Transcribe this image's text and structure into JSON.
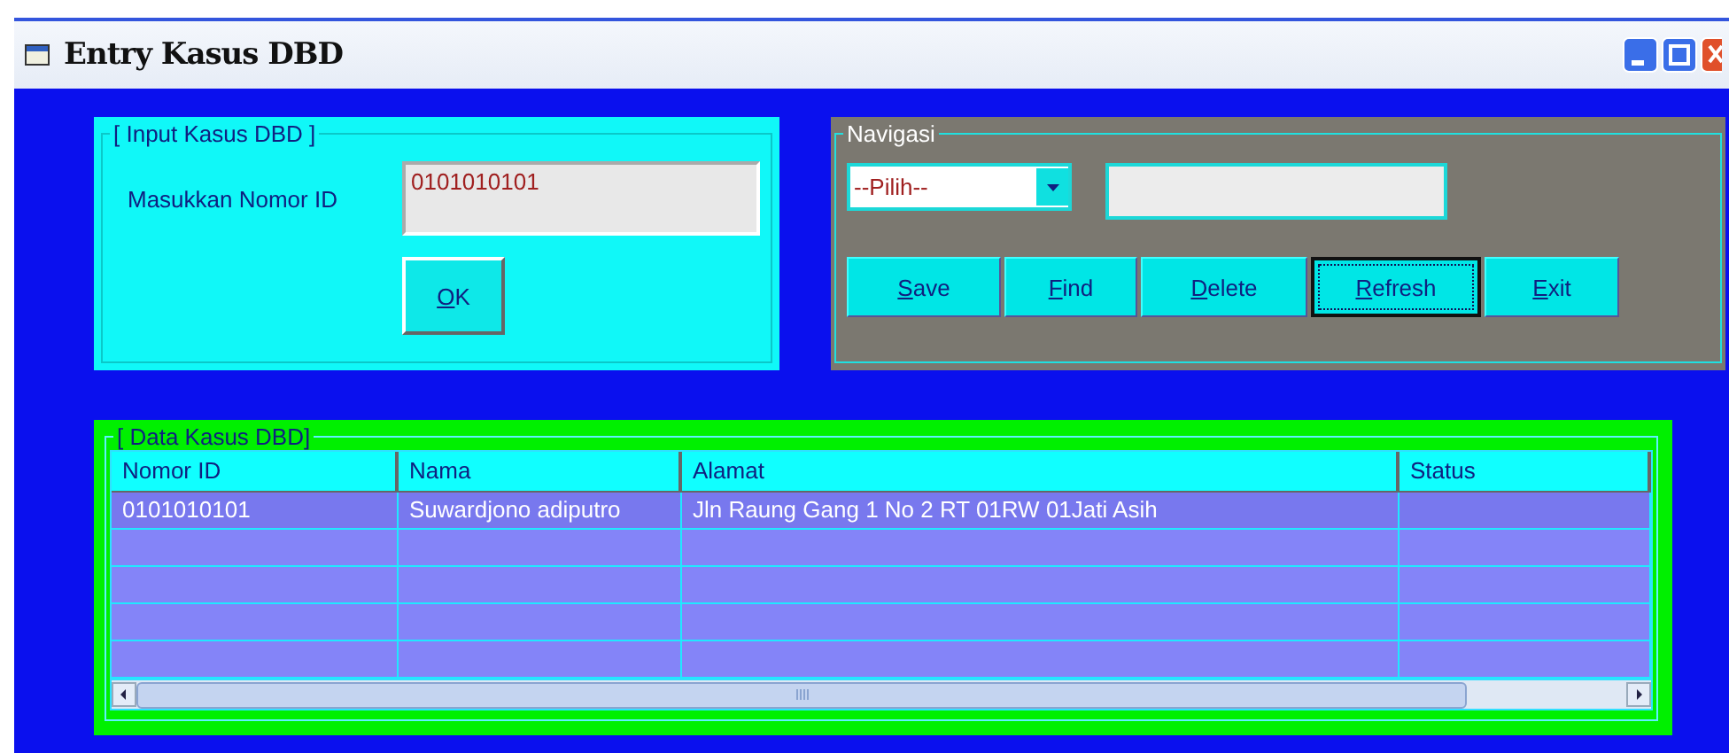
{
  "window": {
    "title": "Entry Kasus DBD"
  },
  "input_panel": {
    "title": "[ Input Kasus DBD ]",
    "label": "Masukkan Nomor ID",
    "value": "0101010101",
    "ok_button": "OK"
  },
  "navigation_panel": {
    "title": "Navigasi",
    "dropdown": "--Pilih--",
    "buttons": [
      {
        "label": "Save",
        "focused": false
      },
      {
        "label": "Find",
        "focused": false
      },
      {
        "label": "Delete",
        "focused": false
      },
      {
        "label": "Refresh",
        "focused": true
      },
      {
        "label": "Exit",
        "focused": false
      }
    ]
  },
  "data_panel": {
    "title": "[ Data Kasus DBD]",
    "columns": [
      "Nomor ID",
      "Nama",
      "Alamat",
      "Status"
    ],
    "rows": [
      {
        "nomor_id": "0101010101",
        "nama": "Suwardjono adiputro",
        "alamat": "Jln Raung Gang 1 No 2 RT 01RW 01Jati Asih"
      }
    ]
  }
}
